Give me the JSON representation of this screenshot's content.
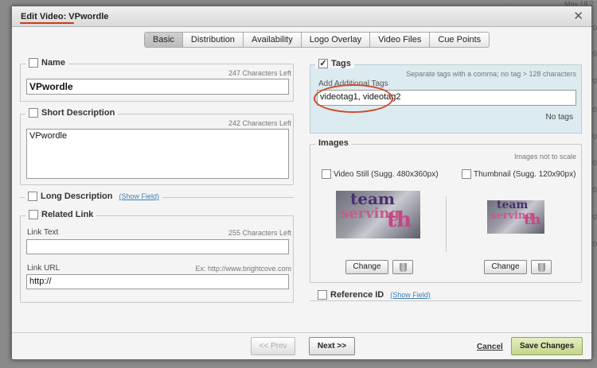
{
  "background": {
    "date": "May 19 2",
    "nums": [
      "20",
      "20",
      "20",
      "20",
      "20",
      "20",
      "20",
      "20",
      "20"
    ]
  },
  "dialog": {
    "title": "Edit Video: VPwordle",
    "tabs": [
      "Basic",
      "Distribution",
      "Availability",
      "Logo Overlay",
      "Video Files",
      "Cue Points"
    ],
    "active_tab": "Basic"
  },
  "name": {
    "label": "Name",
    "hint": "247 Characters Left",
    "value": "VPwordle"
  },
  "short_description": {
    "label": "Short Description",
    "hint": "242 Characters Left",
    "value": "VPwordle"
  },
  "long_description": {
    "label": "Long Description",
    "show_field": "(Show Field)"
  },
  "related_link": {
    "label": "Related Link",
    "link_text_label": "Link Text",
    "link_text_hint": "255 Characters Left",
    "link_text_value": "",
    "link_url_label": "Link URL",
    "link_url_hint": "Ex: http://www.brightcove.com",
    "link_url_value": "http://"
  },
  "tags": {
    "label": "Tags",
    "checked": true,
    "check_glyph": "✓",
    "hint": "Separate tags with a comma; no tag > 128 characters",
    "add_label": "Add Additional Tags",
    "value": "videotag1, videotag2",
    "empty": "No tags"
  },
  "images": {
    "label": "Images",
    "hint": "Images not to scale",
    "video_still_label": "Video Still (Sugg. 480x360px)",
    "thumbnail_label": "Thumbnail (Sugg. 120x90px)",
    "change_label": "Change",
    "thumb_words": [
      "team",
      "serving",
      "th"
    ]
  },
  "reference_id": {
    "label": "Reference ID",
    "show_field": "(Show Field)"
  },
  "footer": {
    "prev": "<< Prev",
    "next": "Next >>",
    "cancel": "Cancel",
    "save": "Save Changes"
  },
  "colors": {
    "annotation": "#d04a2a",
    "save_button": "#cfe0a0"
  }
}
